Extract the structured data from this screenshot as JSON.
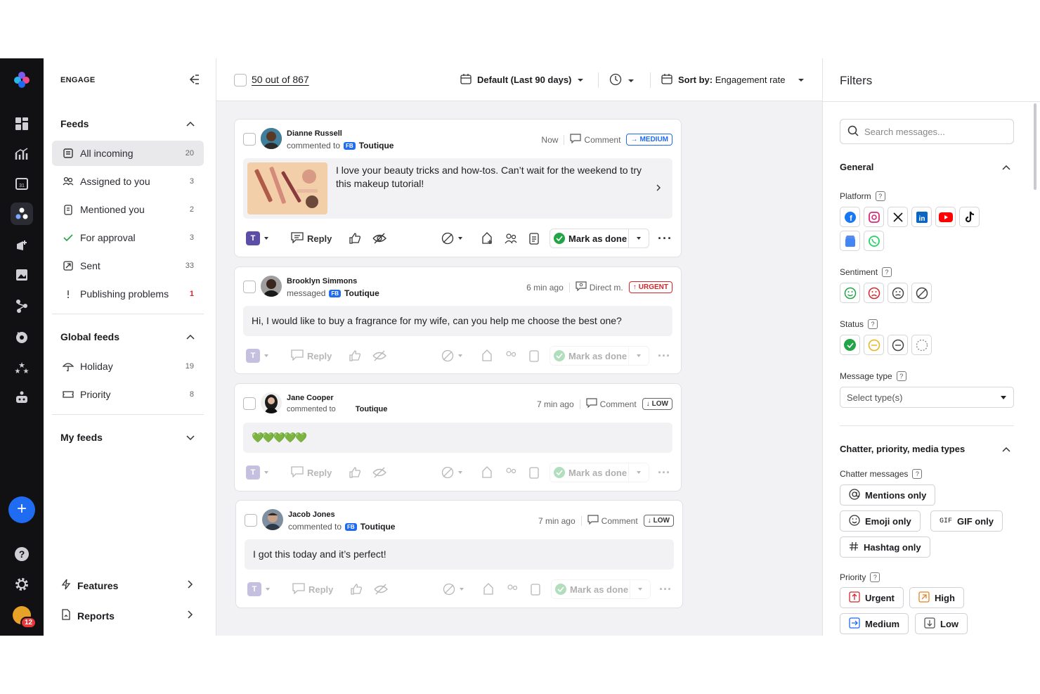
{
  "sidebar": {
    "section_title": "ENGAGE",
    "feeds_title": "Feeds",
    "items": [
      {
        "label": "All incoming",
        "count": "20"
      },
      {
        "label": "Assigned to you",
        "count": "3"
      },
      {
        "label": "Mentioned you",
        "count": "2"
      },
      {
        "label": "For approval",
        "count": "3"
      },
      {
        "label": "Sent",
        "count": "33"
      },
      {
        "label": "Publishing problems",
        "count": "1"
      }
    ],
    "global_title": "Global feeds",
    "global_items": [
      {
        "label": "Holiday",
        "count": "19"
      },
      {
        "label": "Priority",
        "count": "8"
      }
    ],
    "my_feeds_title": "My feeds",
    "features_label": "Features",
    "reports_label": "Reports",
    "avatar_badge": "12"
  },
  "toolbar": {
    "count_label": "50 out of 867",
    "date_label": "Default (Last 90 days)",
    "sort_prefix": "Sort by:",
    "sort_value": "Engagement rate"
  },
  "cards": [
    {
      "name": "Dianne Russell",
      "action": "commented to",
      "brand": "Toutique",
      "platform_badge": "FB",
      "time": "Now",
      "type": "Comment",
      "priority": "MEDIUM",
      "message": "I love your beauty tricks and how-tos. Can’t wait for the weekend to try this makeup tutorial!"
    },
    {
      "name": "Brooklyn Simmons",
      "action": "messaged",
      "brand": "Toutique",
      "platform_badge": "FB",
      "time": "6 min ago",
      "type": "Direct m.",
      "priority": "URGENT",
      "message": "Hi, I would like to buy a fragrance for my wife, can you help me choose the best one?"
    },
    {
      "name": "Jane Cooper",
      "action": "commented to",
      "brand": "Toutique",
      "platform_badge": "",
      "time": "7 min ago",
      "type": "Comment",
      "priority": "LOW",
      "message": "💚💚💚💚💚"
    },
    {
      "name": "Jacob Jones",
      "action": "commented to",
      "brand": "Toutique",
      "platform_badge": "FB",
      "time": "7 min ago",
      "type": "Comment",
      "priority": "LOW",
      "message": "I got this today and it’s perfect!"
    }
  ],
  "card_actions": {
    "reply": "Reply",
    "mark_done": "Mark as done"
  },
  "filters": {
    "title": "Filters",
    "search_placeholder": "Search messages...",
    "general_title": "General",
    "platform_label": "Platform",
    "sentiment_label": "Sentiment",
    "status_label": "Status",
    "message_type_label": "Message type",
    "message_type_placeholder": "Select type(s)",
    "chatter_title": "Chatter, priority, media types",
    "chatter_label": "Chatter messages",
    "chips": [
      "Mentions only",
      "Emoji only",
      "GIF only",
      "Hashtag only"
    ],
    "gif_tag": "GIF",
    "priority_label": "Priority",
    "priority_chips": [
      "Urgent",
      "High",
      "Medium",
      "Low"
    ],
    "help_glyph": "?"
  },
  "colors": {
    "accent": "#1f6bf2",
    "urgent": "#d3262c",
    "success": "#22a447",
    "high": "#e8811f"
  }
}
